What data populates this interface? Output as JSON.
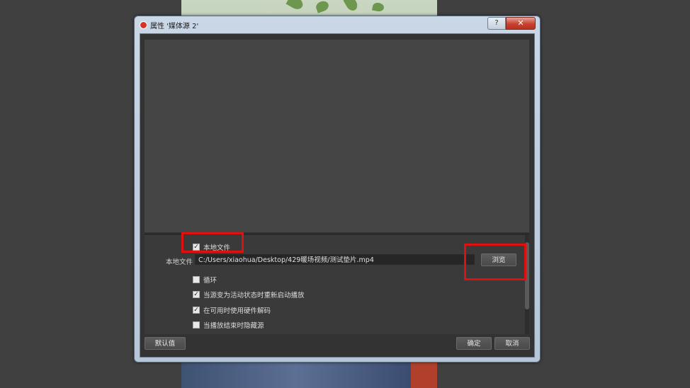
{
  "window": {
    "title": "属性 '媒体源 2'",
    "help_label": "?",
    "close_label": "✕",
    "app_icon": "obs-icon"
  },
  "properties": {
    "local_file_checkbox": {
      "label": "本地文件",
      "checked": true,
      "mark": "✓"
    },
    "local_file": {
      "label": "本地文件",
      "value": "C:/Users/xiaohua/Desktop/429暖场视频/测试垫片.mp4",
      "browse_label": "浏览"
    },
    "loop": {
      "label": "循环",
      "checked": false,
      "mark": ""
    },
    "restart_on_activate": {
      "label": "当源变为活动状态时重新启动播放",
      "checked": true,
      "mark": "✓"
    },
    "hw_decode": {
      "label": "在可用时使用硬件解码",
      "checked": true,
      "mark": "✓"
    },
    "hide_on_end": {
      "label": "当播放结束时隐藏源",
      "checked": false,
      "mark": ""
    }
  },
  "footer": {
    "defaults_label": "默认值",
    "ok_label": "确定",
    "cancel_label": "取消"
  },
  "highlight_color": "#e01010"
}
